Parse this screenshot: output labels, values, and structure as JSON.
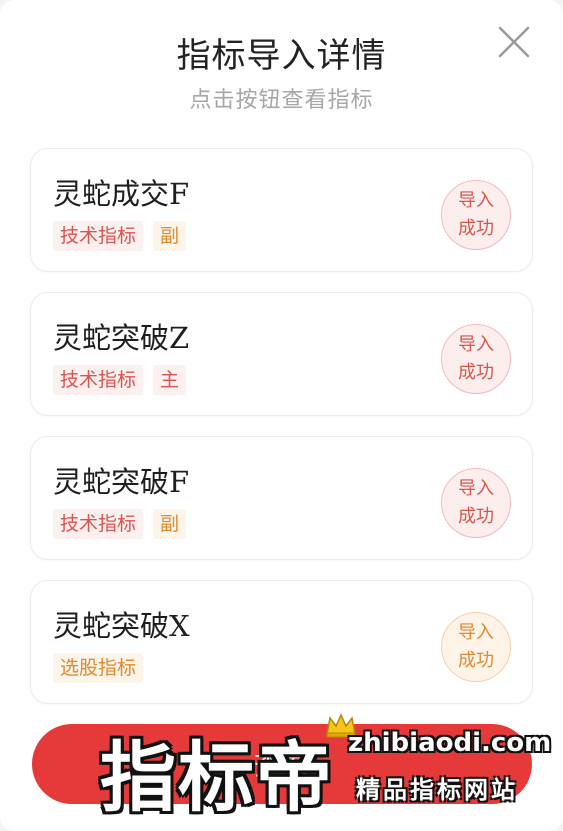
{
  "dialog": {
    "title": "指标导入详情",
    "subtitle": "点击按钮查看指标",
    "close_icon": "close-icon"
  },
  "items": [
    {
      "name": "灵蛇成交F",
      "tags": [
        {
          "label": "技术指标",
          "color": "#d9534f"
        },
        {
          "label": "副",
          "color": "#e0892a"
        }
      ],
      "status": {
        "line1": "导入",
        "line2": "成功",
        "tone": "red"
      }
    },
    {
      "name": "灵蛇突破Z",
      "tags": [
        {
          "label": "技术指标",
          "color": "#d9534f"
        },
        {
          "label": "主",
          "color": "#d9534f"
        }
      ],
      "status": {
        "line1": "导入",
        "line2": "成功",
        "tone": "red"
      }
    },
    {
      "name": "灵蛇突破F",
      "tags": [
        {
          "label": "技术指标",
          "color": "#d9534f"
        },
        {
          "label": "副",
          "color": "#e0892a"
        }
      ],
      "status": {
        "line1": "导入",
        "line2": "成功",
        "tone": "red"
      }
    },
    {
      "name": "灵蛇突破X",
      "tags": [
        {
          "label": "选股指标",
          "color": "#e0892a"
        }
      ],
      "status": {
        "line1": "导入",
        "line2": "成功",
        "tone": "orange"
      }
    }
  ],
  "bottom_button": {
    "label": "查看",
    "color": "#e63a3a"
  },
  "watermark": {
    "big_text": "指标帝",
    "domain": "zhibiaodi.com",
    "slogan": "精品指标网站"
  }
}
